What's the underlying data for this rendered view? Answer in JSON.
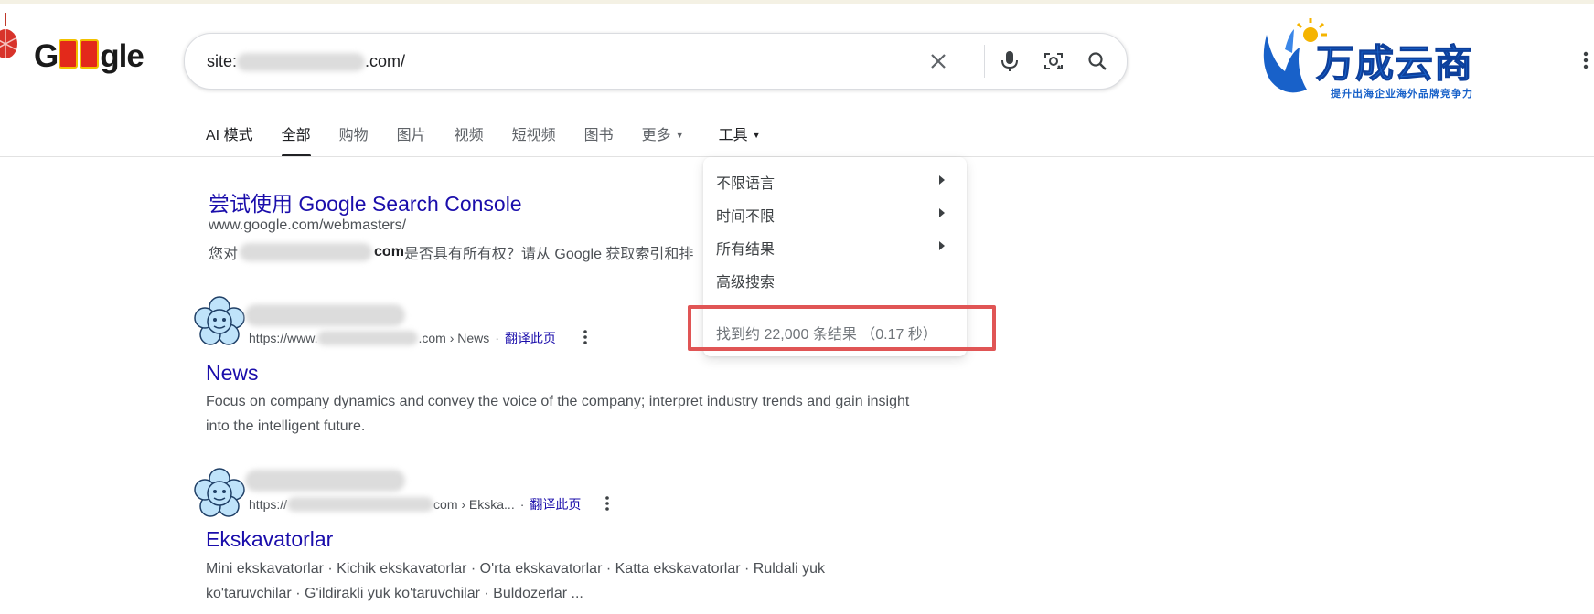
{
  "search": {
    "query_prefix": "site:",
    "query_suffix": ".com/"
  },
  "logo": {
    "left": "G",
    "right": "gle"
  },
  "brand": {
    "name": "万成云商",
    "tagline": "提升出海企业海外品牌竞争力"
  },
  "tabs": [
    {
      "label": "AI 模式"
    },
    {
      "label": "全部",
      "active": true
    },
    {
      "label": "购物"
    },
    {
      "label": "图片"
    },
    {
      "label": "视频"
    },
    {
      "label": "短视频"
    },
    {
      "label": "图书"
    },
    {
      "label": "更多"
    },
    {
      "label": "工具"
    }
  ],
  "tools_menu": {
    "items": [
      {
        "label": "不限语言",
        "has_submenu": true
      },
      {
        "label": "时间不限",
        "has_submenu": true
      },
      {
        "label": "所有结果",
        "has_submenu": true
      },
      {
        "label": "高级搜索",
        "has_submenu": false
      }
    ],
    "stats": "找到约 22,000 条结果 （0.17 秒）"
  },
  "result1": {
    "title": "尝试使用 Google Search Console",
    "url": "www.google.com/webmasters/",
    "snippet_prefix": "您对",
    "snippet_bold": "com",
    "snippet_suffix": " 是否具有所有权？请从 Google 获取索引和排"
  },
  "result2": {
    "cite_prefix": "https://www.",
    "cite_suffix": ".com › News",
    "translate": "翻译此页",
    "title": "News",
    "snippet": "Focus on company dynamics and convey the voice of the company; interpret industry trends and gain insight into the intelligent future."
  },
  "result3": {
    "cite_prefix": "https://",
    "cite_suffix": "com › Ekska...",
    "translate": "翻译此页",
    "title": "Ekskavatorlar",
    "snippet": "Mini ekskavatorlar · Kichik ekskavatorlar · O'rta ekskavatorlar · Katta ekskavatorlar · Ruldali yuk ko'taruvchilar · G'ildirakli yuk ko'taruvchilar · Buldozerlar ..."
  },
  "colors": {
    "link": "#1a0dab",
    "highlight_box": "#e05555",
    "brand_blue": "#1861c9"
  }
}
